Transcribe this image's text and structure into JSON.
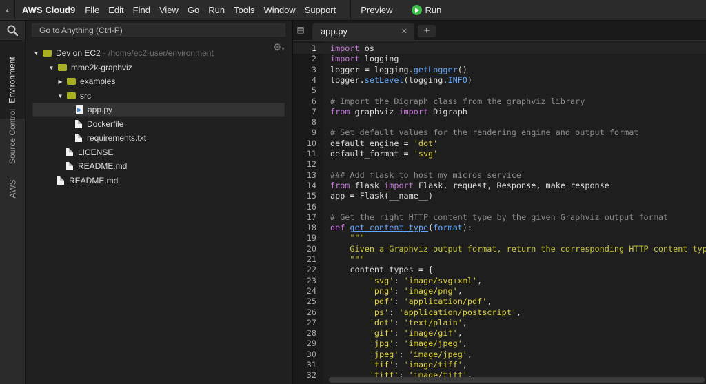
{
  "menubar": {
    "brand": "AWS Cloud9",
    "menus": [
      "File",
      "Edit",
      "Find",
      "View",
      "Go",
      "Run",
      "Tools",
      "Window",
      "Support"
    ],
    "preview_label": "Preview",
    "run_label": "Run"
  },
  "sidebar": {
    "tabs": [
      "Environment",
      "Source Control",
      "AWS"
    ],
    "active_tab": "Environment"
  },
  "search": {
    "placeholder": "Go to Anything (Ctrl-P)"
  },
  "tree": {
    "root": {
      "label": "Dev on EC2",
      "path": "- /home/ec2-user/environment"
    },
    "project": "mme2k-graphviz",
    "examples": "examples",
    "src": "src",
    "app": "app.py",
    "dockerfile": "Dockerfile",
    "requirements": "requirements.txt",
    "license": "LICENSE",
    "readme_project": "README.md",
    "readme_root": "README.md"
  },
  "editor": {
    "tab_label": "app.py",
    "current_line": 1,
    "line_numbers": [
      "1",
      "2",
      "3",
      "4",
      "5",
      "6",
      "7",
      "8",
      "9",
      "10",
      "11",
      "12",
      "13",
      "14",
      "15",
      "16",
      "17",
      "18",
      "19",
      "20",
      "21",
      "22",
      "23",
      "24",
      "25",
      "26",
      "27",
      "28",
      "29",
      "30",
      "31",
      "32"
    ],
    "lines": {
      "l1": {
        "kw": "import",
        "rest": " os"
      },
      "l2": {
        "kw": "import",
        "rest": " logging"
      },
      "l3": {
        "a": "logger = logging.",
        "fn": "getLogger",
        "b": "()"
      },
      "l4": {
        "a": "logger.",
        "fn": "setLevel",
        "b": "(logging.",
        "fn2": "INFO",
        "c": ")"
      },
      "l6": "# Import the Digraph class from the graphviz library",
      "l7": {
        "kw1": "from",
        "a": " graphviz ",
        "kw2": "import",
        "b": " Digraph"
      },
      "l9": "# Set default values for the rendering engine and output format",
      "l10": {
        "a": "default_engine = ",
        "s": "'dot'"
      },
      "l11": {
        "a": "default_format = ",
        "s": "'svg'"
      },
      "l13": "### Add flask to host my micros service",
      "l14": {
        "kw1": "from",
        "a": " flask ",
        "kw2": "import",
        "b": " Flask, request, Response, make_response"
      },
      "l15": "app = Flask(__name__)",
      "l17": "# Get the right HTTP content type by the given Graphviz output format",
      "l18": {
        "kw": "def",
        "fn": "get_content_type",
        "a": "(",
        "p": "format",
        "b": "):"
      },
      "l19": "    \"\"\"",
      "l20": "    Given a Graphviz output format, return the corresponding HTTP content type.",
      "l21": "    \"\"\"",
      "l22": "    content_types = {",
      "l23": {
        "k": "'svg'",
        "v": "'image/svg+xml'"
      },
      "l24": {
        "k": "'png'",
        "v": "'image/png'"
      },
      "l25": {
        "k": "'pdf'",
        "v": "'application/pdf'"
      },
      "l26": {
        "k": "'ps'",
        "v": "'application/postscript'"
      },
      "l27": {
        "k": "'dot'",
        "v": "'text/plain'"
      },
      "l28": {
        "k": "'gif'",
        "v": "'image/gif'"
      },
      "l29": {
        "k": "'jpg'",
        "v": "'image/jpeg'"
      },
      "l30": {
        "k": "'jpeg'",
        "v": "'image/jpeg'"
      },
      "l31": {
        "k": "'tif'",
        "v": "'image/tiff'"
      },
      "l32": {
        "k": "'tiff'",
        "v": "'image/tiff'"
      }
    }
  },
  "colors": {
    "keyword": "#c678dd",
    "string": "#ded23c",
    "function": "#61a7ff",
    "comment": "#8c8c8c",
    "run": "#3fbf4a",
    "folder": "#a6b020"
  }
}
